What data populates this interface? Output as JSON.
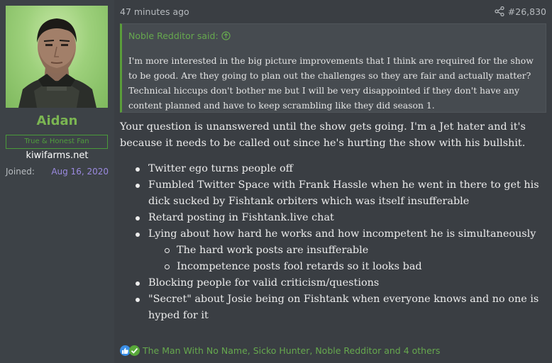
{
  "user": {
    "name": "Aidan",
    "title": "True & Honest Fan",
    "site": "kiwifarms.net",
    "joined_label": "Joined:",
    "joined_date": "Aug 16, 2020"
  },
  "post": {
    "timestamp": "47 minutes ago",
    "number": "#26,830",
    "quote": {
      "author_line": "Noble Redditor said:",
      "lines": [
        "I'm more interested in the big picture improvements that I think are required for the show",
        "to be good. Are they going to plan out the challenges so they are fair and actually matter?",
        "Technical hiccups don't bother me but I will be very disappointed if they don't have any",
        "content planned and have to keep scrambling like they did season 1."
      ]
    },
    "intro_lines": [
      "Your question is unanswered until the show gets going. I'm a Jet hater and it's",
      "because it needs to be called out since he's hurting the show with his bullshit."
    ],
    "bullets": [
      {
        "level": 1,
        "lines": [
          "Twitter ego turns people off"
        ]
      },
      {
        "level": 1,
        "lines": [
          "Fumbled Twitter Space with Frank Hassle when he went in there to get his",
          "dick sucked by Fishtank orbiters which was itself insufferable"
        ]
      },
      {
        "level": 1,
        "lines": [
          "Retard posting in Fishtank.live chat"
        ]
      },
      {
        "level": 1,
        "lines": [
          "Lying about how hard he works and how incompetent he is simultaneously"
        ]
      },
      {
        "level": 2,
        "lines": [
          "The hard work posts are insufferable"
        ]
      },
      {
        "level": 2,
        "lines": [
          "Incompetence posts fool retards so it looks bad"
        ]
      },
      {
        "level": 1,
        "lines": [
          "Blocking people for valid criticism/questions"
        ]
      },
      {
        "level": 1,
        "lines": [
          "\"Secret\" about Josie being on Fishtank when everyone knows and no one is",
          "hyped for it"
        ]
      }
    ],
    "reactions_text": "The Man With No Name, Sicko Hunter, Noble Redditor and 4 others"
  },
  "colors": {
    "accent_green": "#66a84e",
    "username_green": "#7bb552",
    "joined_purple": "#9b8ae0",
    "like_blue": "#3a8ee6"
  },
  "icons": {
    "share": "share-icon",
    "quote_jump": "arrow-up-circle-icon",
    "like": "thumbs-up-icon",
    "agree": "checkmark-icon"
  }
}
